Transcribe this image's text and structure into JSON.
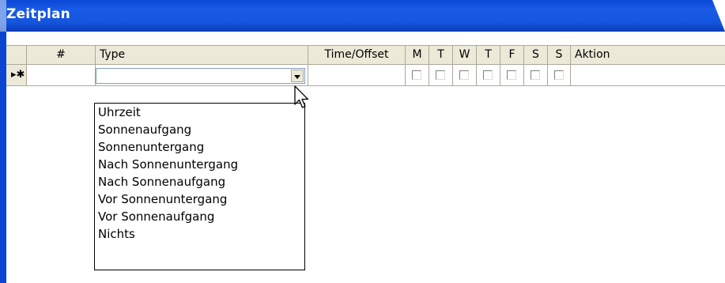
{
  "window": {
    "title": "Zeitplan"
  },
  "grid": {
    "columns": {
      "number": "#",
      "type": "Type",
      "time_offset": "Time/Offset",
      "mon": "M",
      "tue": "T",
      "wed": "W",
      "thu": "T",
      "fri": "F",
      "sat": "S",
      "sun": "S",
      "action": "Aktion"
    },
    "new_row": {
      "selector_glyph": "▸✱",
      "type_value": "",
      "checkboxes_checked": [
        false,
        false,
        false,
        false,
        false,
        false,
        false
      ]
    }
  },
  "type_dropdown": {
    "options": [
      "Uhrzeit",
      "Sonnenaufgang",
      "Sonnenuntergang",
      "Nach Sonnenuntergang",
      "Nach Sonnenaufgang",
      "Vor Sonnenuntergang",
      "Vor Sonnenaufgang",
      "Nichts"
    ]
  },
  "colors": {
    "titlebar": "#1456de",
    "header_bg": "#ece9d8",
    "grid_line": "#aca899"
  }
}
